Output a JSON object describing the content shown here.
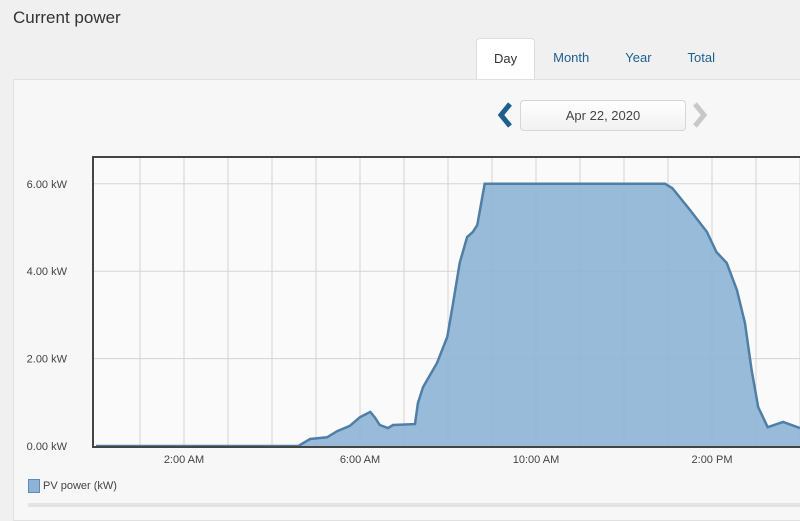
{
  "header": {
    "title": "Current power"
  },
  "tabs": [
    {
      "label": "Day",
      "active": true
    },
    {
      "label": "Month",
      "active": false
    },
    {
      "label": "Year",
      "active": false
    },
    {
      "label": "Total",
      "active": false
    }
  ],
  "date_nav": {
    "date": "Apr 22, 2020",
    "prev_icon": "chevron-left-icon",
    "next_icon": "chevron-right-icon",
    "prev_color": "#1d5f8f",
    "next_color": "#c8c8c8"
  },
  "colors": {
    "fill": "#8db4d6",
    "line": "#4f7fa6",
    "accent": "#1d5f8f"
  },
  "chart_data": {
    "type": "area",
    "title": "",
    "xlabel": "",
    "ylabel": "",
    "x_ticks": [
      "2:00 AM",
      "6:00 AM",
      "10:00 AM",
      "2:00 PM"
    ],
    "y_ticks": [
      "0.00 kW",
      "2.00 kW",
      "4.00 kW",
      "6.00 kW"
    ],
    "ylim": [
      0,
      6.6
    ],
    "xlim": [
      "00:00",
      "16:00"
    ],
    "grid": true,
    "legend": "bottom-left",
    "series": [
      {
        "name": "PV power (kW)",
        "x": [
          "00:00",
          "04:36",
          "04:52",
          "05:15",
          "05:29",
          "05:46",
          "06:00",
          "06:14",
          "06:20",
          "06:27",
          "06:38",
          "06:45",
          "07:15",
          "07:19",
          "07:26",
          "07:45",
          "07:59",
          "08:07",
          "08:16",
          "08:26",
          "08:34",
          "08:40",
          "08:50",
          "12:56",
          "13:06",
          "13:30",
          "13:53",
          "14:06",
          "14:20",
          "14:34",
          "14:45",
          "14:54",
          "15:03",
          "15:16",
          "15:37",
          "16:00"
        ],
        "values": [
          0,
          0,
          0.16,
          0.2,
          0.34,
          0.46,
          0.66,
          0.78,
          0.66,
          0.48,
          0.41,
          0.48,
          0.5,
          0.98,
          1.35,
          1.9,
          2.5,
          3.27,
          4.19,
          4.78,
          4.9,
          5.06,
          6.0,
          6.0,
          5.9,
          5.4,
          4.9,
          4.44,
          4.19,
          3.57,
          2.81,
          1.74,
          0.89,
          0.43,
          0.55,
          0.41
        ]
      }
    ]
  }
}
